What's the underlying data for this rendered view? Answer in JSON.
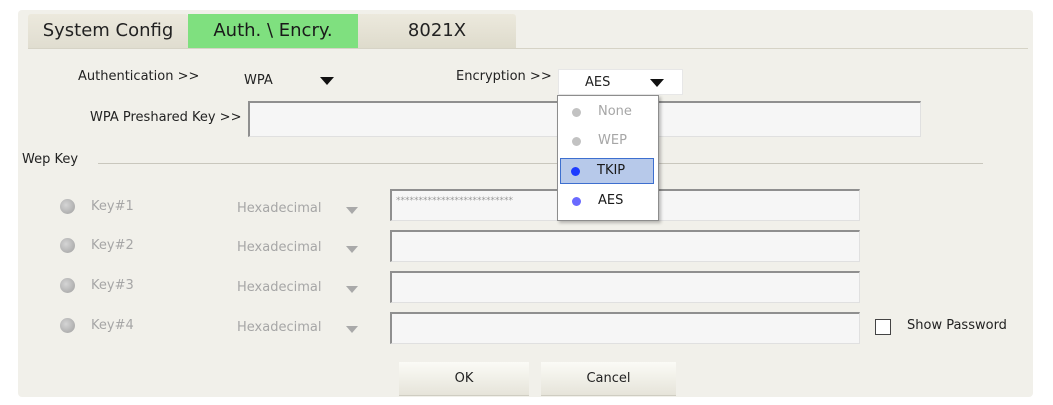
{
  "tabs": [
    {
      "label": "System Config"
    },
    {
      "label": "Auth. \\ Encry."
    },
    {
      "label": "8021X"
    }
  ],
  "auth": {
    "label": "Authentication >>",
    "value": "WPA"
  },
  "encryption": {
    "label": "Encryption >>",
    "value": "AES",
    "options": [
      "None",
      "WEP",
      "TKIP",
      "AES"
    ],
    "highlighted": "TKIP"
  },
  "psk": {
    "label": "WPA Preshared Key >>",
    "value": ""
  },
  "wep": {
    "group_label": "Wep Key",
    "keys": [
      {
        "label": "Key#1",
        "format": "Hexadecimal",
        "value": "**************************"
      },
      {
        "label": "Key#2",
        "format": "Hexadecimal",
        "value": ""
      },
      {
        "label": "Key#3",
        "format": "Hexadecimal",
        "value": ""
      },
      {
        "label": "Key#4",
        "format": "Hexadecimal",
        "value": ""
      }
    ]
  },
  "show_password": {
    "label": "Show Password",
    "checked": false
  },
  "buttons": {
    "ok": "OK",
    "cancel": "Cancel"
  },
  "colors": {
    "active_tab": "#7fe07f",
    "highlight": "#b7c9ea",
    "tkip_dot": "#1e3cff",
    "aes_dot": "#6a6aff"
  }
}
